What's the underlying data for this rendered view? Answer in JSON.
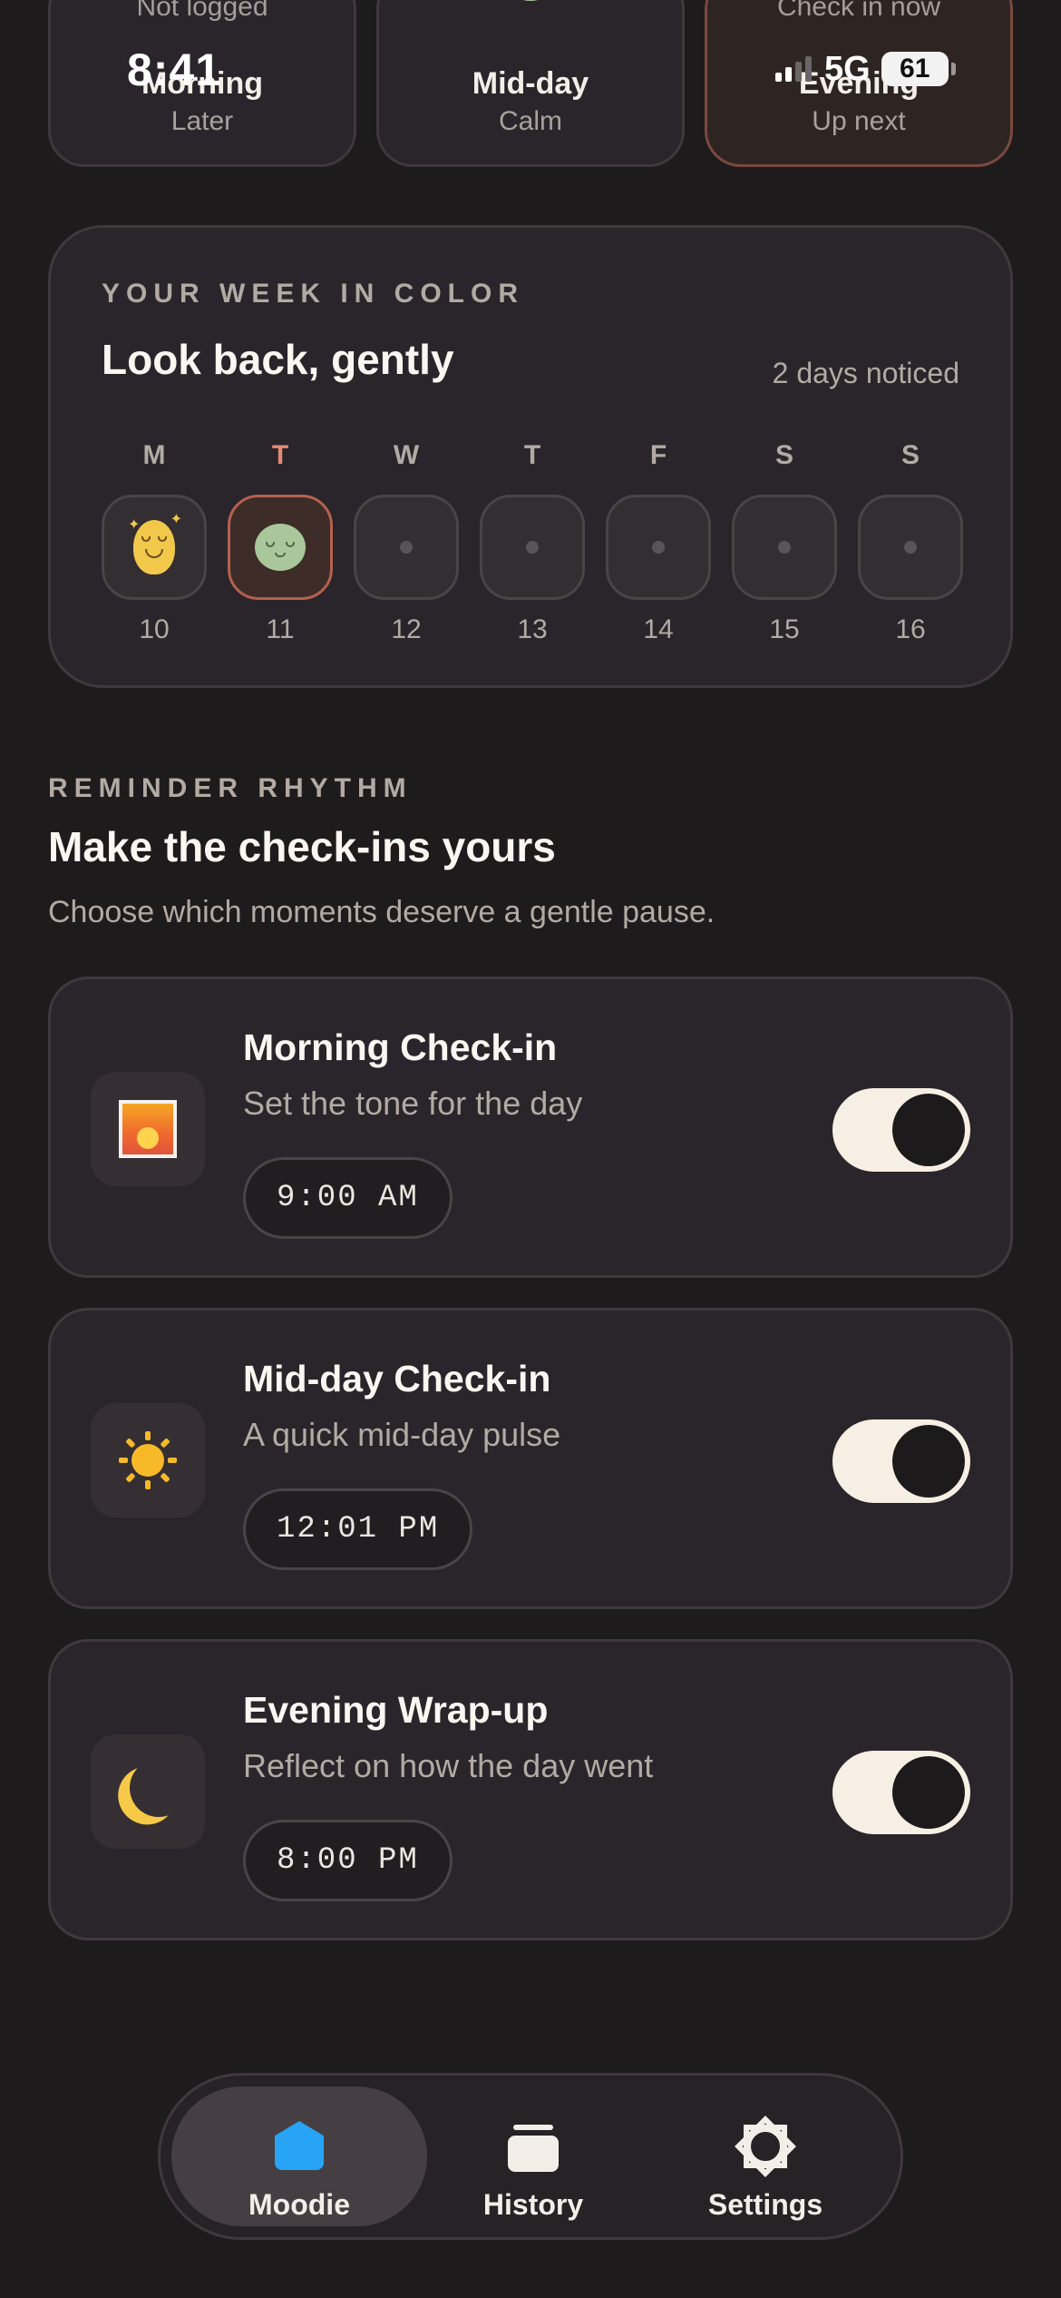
{
  "status_bar": {
    "time": "8:41",
    "network": "5G",
    "battery": "61"
  },
  "slots": [
    {
      "top_note": "Not logged",
      "name": "Morning",
      "sub": "Later"
    },
    {
      "top_note": "",
      "name": "Mid-day",
      "sub": "Calm"
    },
    {
      "top_note": "Check in now",
      "name": "Evening",
      "sub": "Up next"
    }
  ],
  "week": {
    "eyebrow": "YOUR WEEK IN COLOR",
    "title": "Look back, gently",
    "noticed": "2 days noticed",
    "days": [
      {
        "letter": "M",
        "num": "10",
        "mood": "smile"
      },
      {
        "letter": "T",
        "num": "11",
        "mood": "calm",
        "today": true
      },
      {
        "letter": "W",
        "num": "12",
        "mood": "none"
      },
      {
        "letter": "T",
        "num": "13",
        "mood": "none"
      },
      {
        "letter": "F",
        "num": "14",
        "mood": "none"
      },
      {
        "letter": "S",
        "num": "15",
        "mood": "none"
      },
      {
        "letter": "S",
        "num": "16",
        "mood": "none"
      }
    ]
  },
  "reminders": {
    "eyebrow": "REMINDER RHYTHM",
    "title": "Make the check-ins yours",
    "description": "Choose which moments deserve a gentle pause.",
    "items": [
      {
        "name": "Morning Check-in",
        "sub": "Set the tone for the day",
        "time": "9:00 AM",
        "icon": "sunrise-icon",
        "enabled": true
      },
      {
        "name": "Mid-day Check-in",
        "sub": "A quick mid-day pulse",
        "time": "12:01 PM",
        "icon": "sun-icon",
        "enabled": true
      },
      {
        "name": "Evening Wrap-up",
        "sub": "Reflect on how the day went",
        "time": "8:00 PM",
        "icon": "moon-icon",
        "enabled": true
      }
    ]
  },
  "tabs": [
    {
      "label": "Moodie",
      "icon": "home-icon",
      "active": true
    },
    {
      "label": "History",
      "icon": "history-icon",
      "active": false
    },
    {
      "label": "Settings",
      "icon": "gear-icon",
      "active": false
    }
  ],
  "colors": {
    "accent": "#e58a74",
    "tab_active_icon": "#27a4f5",
    "background": "#1e1b1d"
  }
}
